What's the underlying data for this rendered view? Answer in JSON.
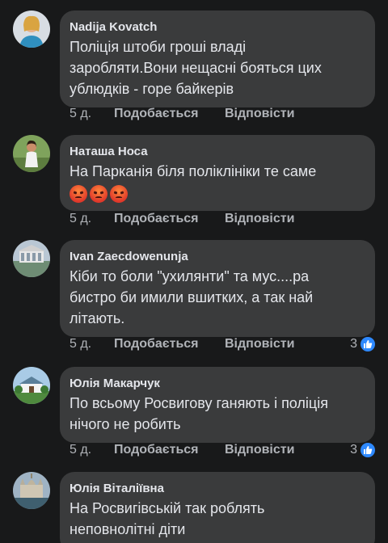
{
  "comments": [
    {
      "author": "Nadija Kovatch",
      "lines": [
        "Поліція штоби гроші владі",
        "заробляти.Вони  нещасні  бояться цих",
        "ублюдків - горе байкерів"
      ],
      "time": "5 д.",
      "like_label": "Подобається",
      "reply_label": "Відповісти"
    },
    {
      "author": "Наташа Носа",
      "lines": [
        "На Парканія біля поліклініки те саме"
      ],
      "emoji": [
        "angry-emoji",
        "angry-emoji",
        "angry-emoji"
      ],
      "time": "5 д.",
      "like_label": "Подобається",
      "reply_label": "Відповісти"
    },
    {
      "author": "Ivan Zaecdowenunja",
      "lines": [
        "Кіби то боли \"ухилянти\" та мус....ра",
        "бистро би имили вшитких, а так най",
        "літають."
      ],
      "time": "5 д.",
      "like_label": "Подобається",
      "reply_label": "Відповісти",
      "reaction_count": "3"
    },
    {
      "author": "Юлія Макарчук",
      "lines": [
        "По всьому Росвигову ганяють і поліція",
        "нічого не робить"
      ],
      "time": "5 д.",
      "like_label": "Подобається",
      "reply_label": "Відповісти",
      "reaction_count": "3"
    },
    {
      "author": "Юлія Віталіївна",
      "lines": [
        "На Росвигівській так роблять",
        "неповнолітні діти"
      ]
    }
  ],
  "colors": {
    "background": "#18191a",
    "bubble": "#3a3b3c",
    "text": "#e4e6eb",
    "secondary_text": "#b0b3b8",
    "like_blue": "#2e89ff"
  }
}
